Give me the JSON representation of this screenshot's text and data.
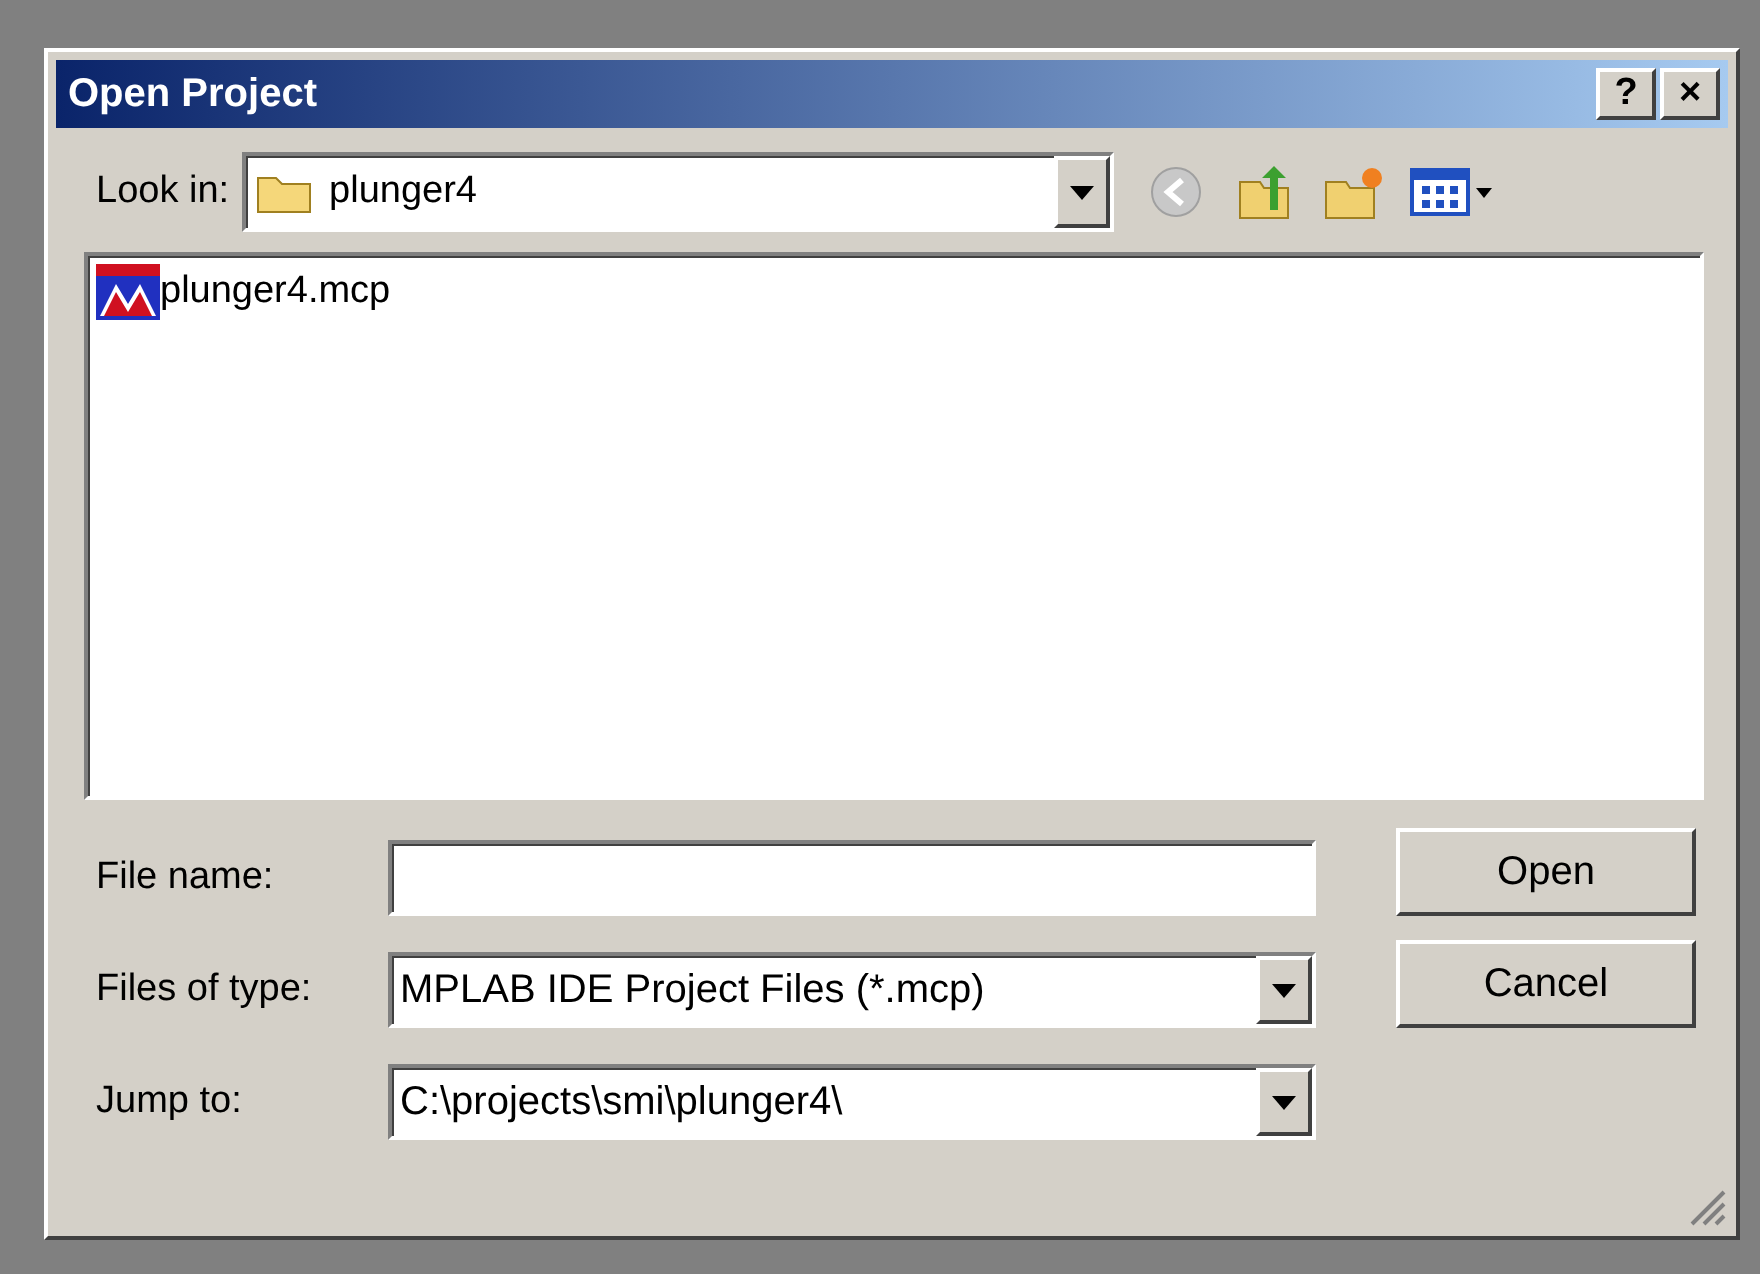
{
  "window": {
    "title": "Open Project",
    "help_button": "?",
    "close_button": "×"
  },
  "look_in": {
    "label": "Look in:",
    "value": "plunger4"
  },
  "files": [
    {
      "name": "plunger4.mcp",
      "selected": false
    }
  ],
  "fields": [
    {
      "kind": "input",
      "label": "File name:"
    },
    {
      "kind": "combo",
      "label": "Files of type:",
      "value": "MPLAB IDE Project Files (*.mcp)"
    },
    {
      "kind": "combo",
      "label": "Jump to:",
      "value": "C:\\projects\\smi\\plunger4\\"
    }
  ],
  "buttons": [
    "Open",
    "Cancel"
  ]
}
